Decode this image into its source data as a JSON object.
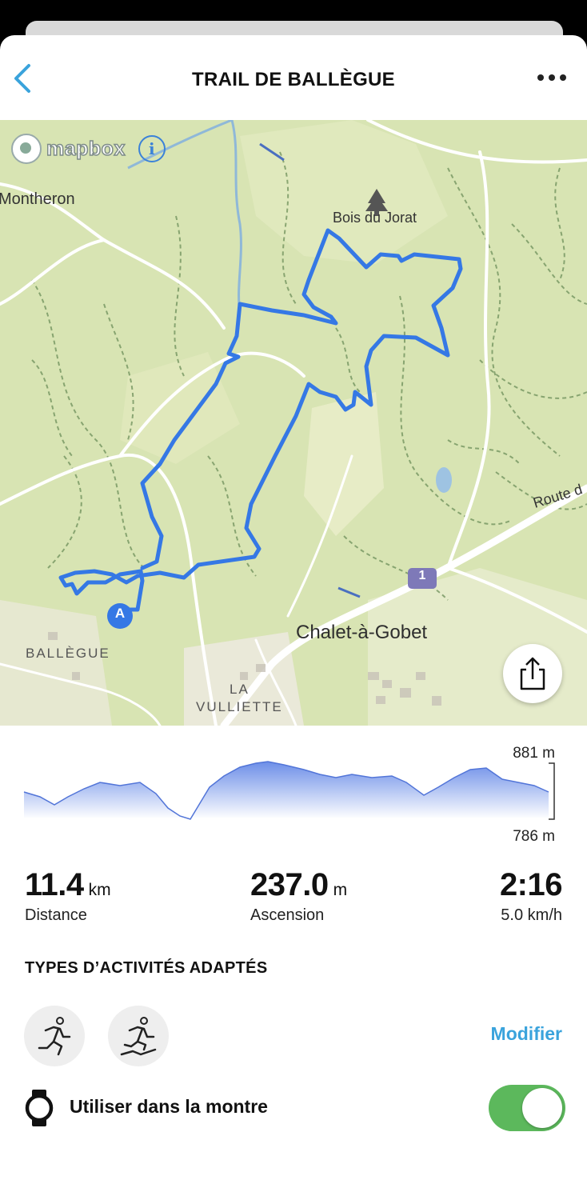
{
  "header": {
    "title": "TRAIL DE BALLÈGUE",
    "back_icon": "chevron-left-icon",
    "more_icon": "more-dots-icon"
  },
  "map": {
    "attribution": "mapbox",
    "info_glyph": "i",
    "labels": {
      "montheron": "Montheron",
      "bois_du_jorat": "Bois du Jorat",
      "route": "Route d",
      "road_number": "1",
      "chalet_a_gobet": "Chalet-à-Gobet",
      "ballegue": "BALLÈGUE",
      "la": "LA",
      "vulliette": "VULLIETTE",
      "start_marker": "A"
    },
    "route_color": "#3578e5",
    "share_icon": "share-icon"
  },
  "elevation": {
    "max": "881 m",
    "min": "786 m",
    "fill_color": "#6c8ee8"
  },
  "stats": {
    "distance": {
      "value": "11.4",
      "unit": "km",
      "label": "Distance"
    },
    "ascent": {
      "value": "237.0",
      "unit": "m",
      "label": "Ascension"
    },
    "time": {
      "value": "2:16",
      "label": "5.0 km/h"
    }
  },
  "activities": {
    "title": "TYPES D’ACTIVITÉS ADAPTÉS",
    "items": [
      {
        "icon": "running-icon"
      },
      {
        "icon": "trail-running-icon"
      }
    ],
    "modify_label": "Modifier"
  },
  "watch": {
    "label": "Utiliser dans la montre",
    "icon": "watch-icon",
    "enabled": true,
    "toggle_color": "#5cb85c"
  }
}
